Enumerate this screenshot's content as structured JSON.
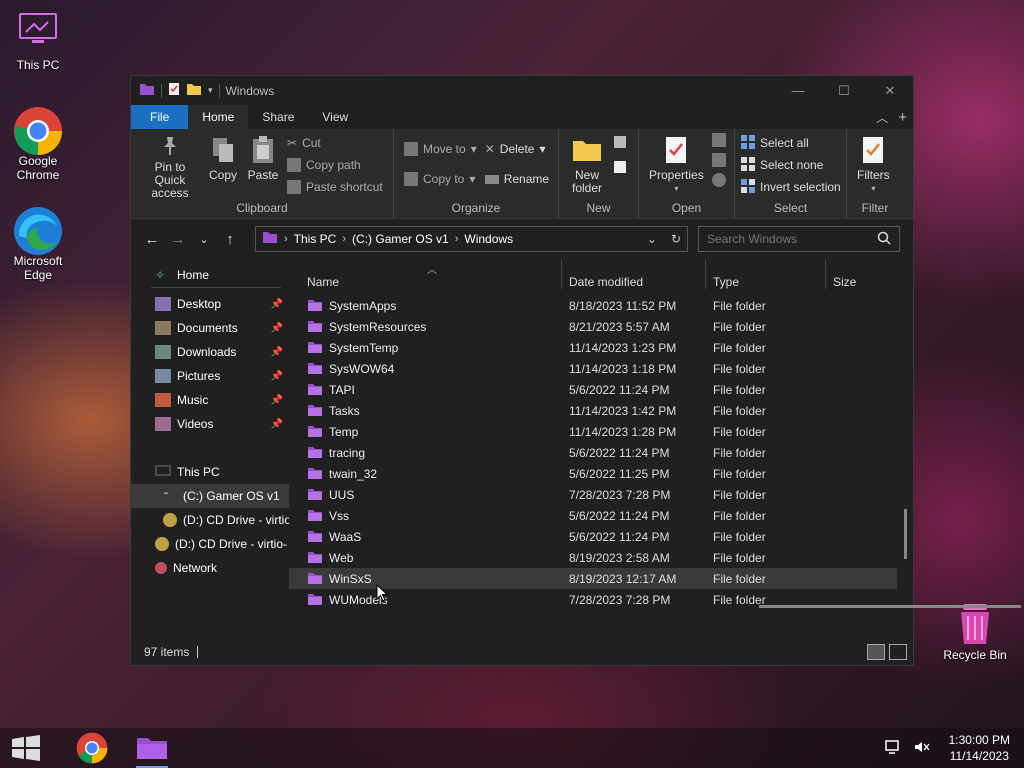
{
  "desktop": {
    "icons": [
      {
        "label": "This PC"
      },
      {
        "label": "Google Chrome"
      },
      {
        "label": "Microsoft Edge"
      },
      {
        "label": "Recycle Bin"
      }
    ]
  },
  "window": {
    "title": "Windows",
    "tabs": {
      "file": "File",
      "home": "Home",
      "share": "Share",
      "view": "View"
    },
    "ribbon": {
      "clipboard": {
        "name": "Clipboard",
        "pin": "Pin to Quick access",
        "copy": "Copy",
        "paste": "Paste",
        "cut": "Cut",
        "copy_path": "Copy path",
        "paste_shortcut": "Paste shortcut"
      },
      "organize": {
        "name": "Organize",
        "move_to": "Move to",
        "copy_to": "Copy to",
        "delete": "Delete",
        "rename": "Rename"
      },
      "new": {
        "name": "New",
        "new_folder": "New folder"
      },
      "open": {
        "name": "Open",
        "properties": "Properties"
      },
      "select": {
        "name": "Select",
        "select_all": "Select all",
        "select_none": "Select none",
        "invert": "Invert selection"
      },
      "filter": {
        "name": "Filter",
        "filters": "Filters"
      }
    },
    "address": {
      "crumbs": [
        "This PC",
        "(C:) Gamer OS v1",
        "Windows"
      ]
    },
    "search": {
      "placeholder": "Search Windows"
    },
    "nav": {
      "home": "Home",
      "desktop": "Desktop",
      "documents": "Documents",
      "downloads": "Downloads",
      "pictures": "Pictures",
      "music": "Music",
      "videos": "Videos",
      "this_pc": "This PC",
      "drive_c": "(C:) Gamer OS v1",
      "drive_d_sub": "(D:) CD Drive - virtio",
      "drive_d": "(D:) CD Drive - virtio-",
      "network": "Network"
    },
    "columns": {
      "name": "Name",
      "date": "Date modified",
      "type": "Type",
      "size": "Size"
    },
    "files": [
      {
        "name": "SystemApps",
        "date": "8/18/2023 11:52 PM",
        "type": "File folder"
      },
      {
        "name": "SystemResources",
        "date": "8/21/2023 5:57 AM",
        "type": "File folder"
      },
      {
        "name": "SystemTemp",
        "date": "11/14/2023 1:23 PM",
        "type": "File folder"
      },
      {
        "name": "SysWOW64",
        "date": "11/14/2023 1:18 PM",
        "type": "File folder"
      },
      {
        "name": "TAPI",
        "date": "5/6/2022 11:24 PM",
        "type": "File folder"
      },
      {
        "name": "Tasks",
        "date": "11/14/2023 1:42 PM",
        "type": "File folder"
      },
      {
        "name": "Temp",
        "date": "11/14/2023 1:28 PM",
        "type": "File folder"
      },
      {
        "name": "tracing",
        "date": "5/6/2022 11:24 PM",
        "type": "File folder"
      },
      {
        "name": "twain_32",
        "date": "5/6/2022 11:25 PM",
        "type": "File folder"
      },
      {
        "name": "UUS",
        "date": "7/28/2023 7:28 PM",
        "type": "File folder"
      },
      {
        "name": "Vss",
        "date": "5/6/2022 11:24 PM",
        "type": "File folder"
      },
      {
        "name": "WaaS",
        "date": "5/6/2022 11:24 PM",
        "type": "File folder"
      },
      {
        "name": "Web",
        "date": "8/19/2023 2:58 AM",
        "type": "File folder"
      },
      {
        "name": "WinSxS",
        "date": "8/19/2023 12:17 AM",
        "type": "File folder"
      },
      {
        "name": "WUModels",
        "date": "7/28/2023 7:28 PM",
        "type": "File folder"
      }
    ],
    "status": {
      "items": "97 items"
    }
  },
  "taskbar": {
    "time": "1:30:00 PM",
    "date": "11/14/2023"
  },
  "colors": {
    "accent": "#1a6fc2",
    "folder": "#9a4fd0",
    "window_bg": "#202020"
  }
}
